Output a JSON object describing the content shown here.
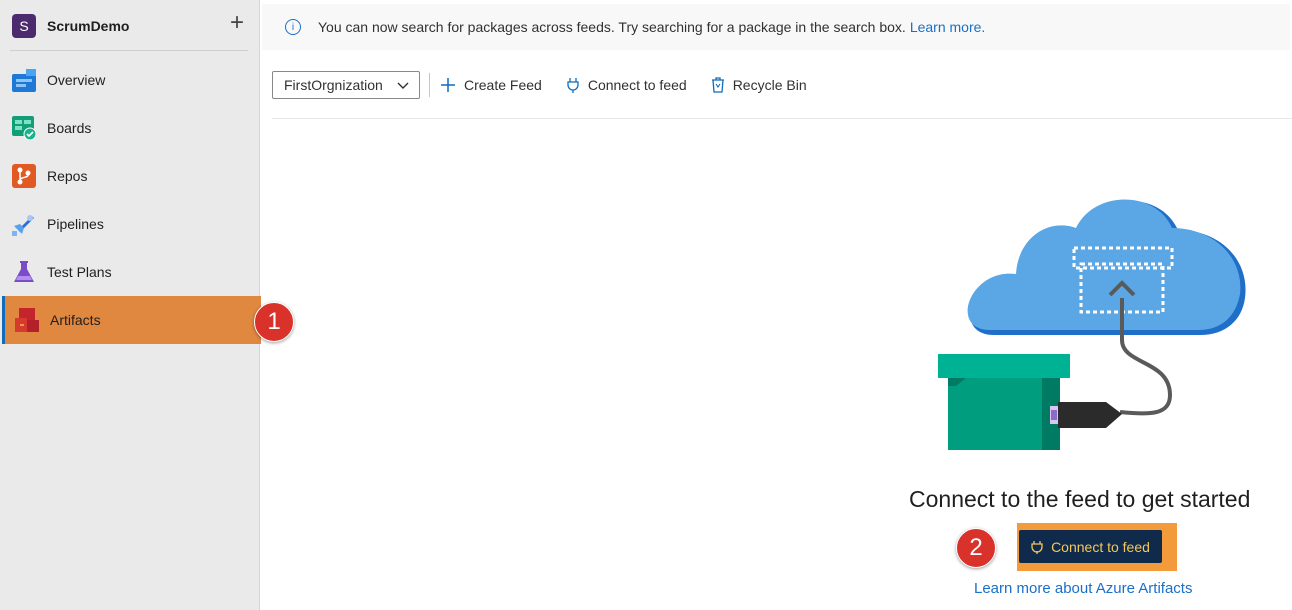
{
  "project": {
    "initial": "S",
    "name": "ScrumDemo",
    "add_symbol": "+"
  },
  "nav": [
    {
      "label": "Overview",
      "icon": "overview-icon"
    },
    {
      "label": "Boards",
      "icon": "boards-icon"
    },
    {
      "label": "Repos",
      "icon": "repos-icon"
    },
    {
      "label": "Pipelines",
      "icon": "pipelines-icon"
    },
    {
      "label": "Test Plans",
      "icon": "test-plans-icon"
    },
    {
      "label": "Artifacts",
      "icon": "artifacts-icon",
      "selected": true
    }
  ],
  "badges": {
    "one": "1",
    "two": "2"
  },
  "banner": {
    "text": "You can now search for packages across feeds. Try searching for a package in the search box.",
    "link": "Learn more."
  },
  "toolbar": {
    "feed_selector": "FirstOrgnization",
    "create_feed": "Create Feed",
    "connect_to_feed": "Connect to feed",
    "recycle_bin": "Recycle Bin"
  },
  "empty_state": {
    "title": "Connect to the feed to get started",
    "button": "Connect to feed",
    "learn_more": "Learn more about Azure Artifacts"
  },
  "colors": {
    "accent": "#0f6cbd",
    "selected_nav": "#e08740",
    "badge": "#d8322b",
    "cta_bg": "#0f2a4a",
    "cta_text": "#f5c85a",
    "cta_highlight": "#f39a3b"
  }
}
